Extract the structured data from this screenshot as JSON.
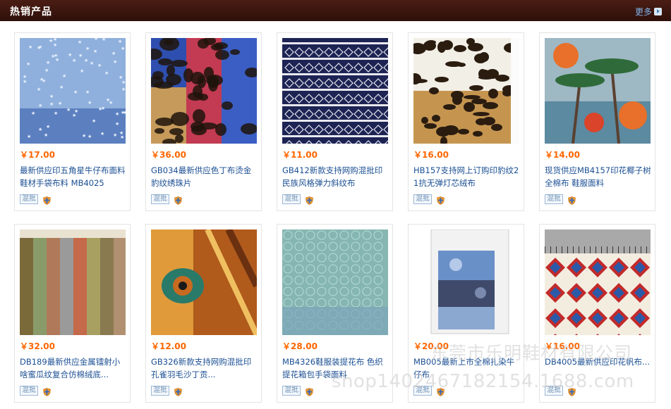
{
  "header": {
    "title": "热销产品",
    "more": "更多"
  },
  "products": [
    {
      "price": "￥17.00",
      "title": "最新供应印五角星牛仔布面料鞋材手袋布料 MB4025",
      "badge": "混批",
      "img": "stars-denim"
    },
    {
      "price": "￥36.00",
      "title": "GB034最新供应色丁布烫金豹纹绣珠片",
      "badge": "混批",
      "img": "leopard-sequin"
    },
    {
      "price": "￥11.00",
      "title": "GB412新款支持网购混批印民族风格弹力斜纹布",
      "badge": "混批",
      "img": "ethnic-navy"
    },
    {
      "price": "￥16.00",
      "title": "HB157支持网上订购印豹纹21抗无弹灯芯绒布",
      "badge": "混批",
      "img": "leopard-corduroy"
    },
    {
      "price": "￥14.00",
      "title": "现货供应MB4157印花椰子树全棉布 鞋服面料",
      "badge": "混批",
      "img": "palm-tree"
    },
    {
      "price": "￥32.00",
      "title": "DB189最新供应金属镭射小啥蜜瓜纹复合仿棉绒底...",
      "badge": "混批",
      "img": "metallic-stripes"
    },
    {
      "price": "￥12.00",
      "title": "GB326新款支持网购混批印孔雀羽毛沙丁贡...",
      "badge": "混批",
      "img": "peacock"
    },
    {
      "price": "￥28.00",
      "title": "MB4326鞋服装提花布 色织提花箱包手袋面料",
      "badge": "混批",
      "img": "jacquard-teal"
    },
    {
      "price": "￥20.00",
      "title": "MB005最新上市全棉扎染牛仔布",
      "badge": "混批",
      "img": "tie-dye"
    },
    {
      "price": "￥16.00",
      "title": "DB4005最新供应印花帆布...",
      "badge": "混批",
      "img": "aztec-canvas"
    }
  ],
  "watermark": {
    "line1": "东莞市乐明鞋材有限公司",
    "line2": "shop1402467182154.1688.com"
  }
}
